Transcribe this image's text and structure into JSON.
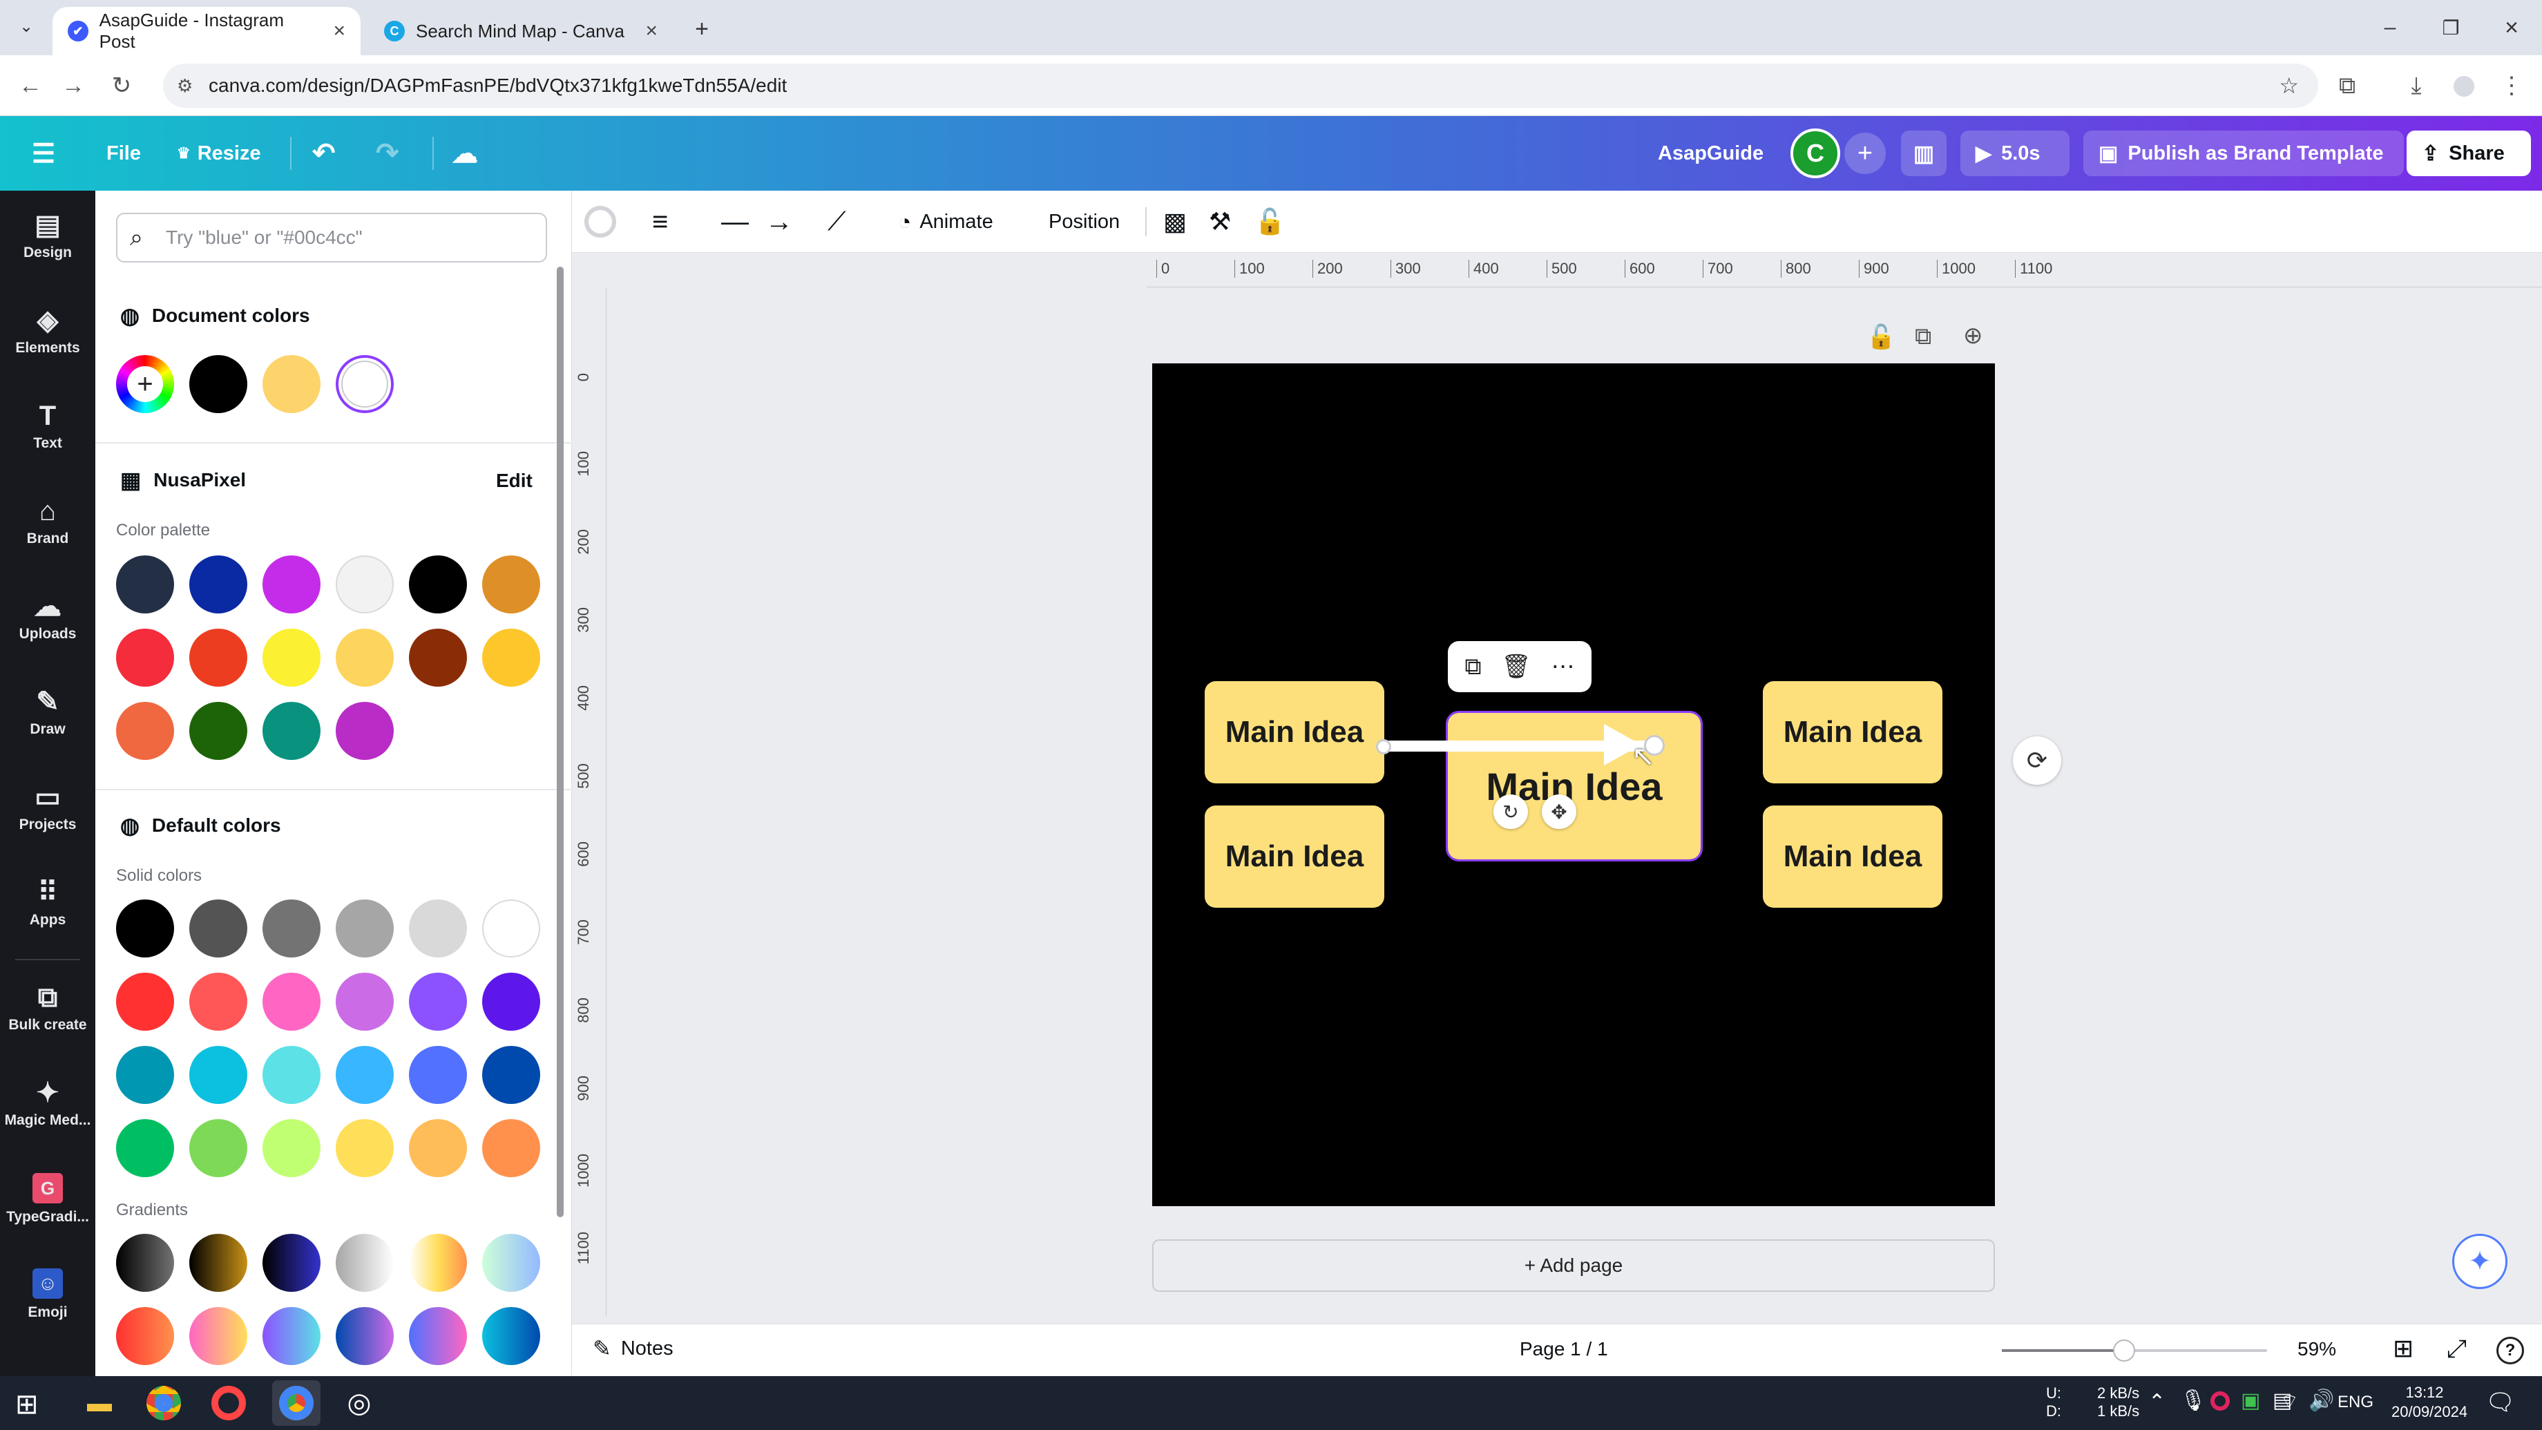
{
  "browser": {
    "tabs": [
      {
        "title": "AsapGuide - Instagram Post",
        "icon": "canva-shield-icon",
        "active": true
      },
      {
        "title": "Search Mind Map - Canva",
        "icon": "canva-icon",
        "active": false
      }
    ],
    "url": "canva.com/design/DAGPmFasnPE/bdVQtx371kfg1kweTdn55A/edit"
  },
  "header": {
    "file_label": "File",
    "resize_label": "Resize",
    "team_name": "AsapGuide",
    "avatar_letter": "C",
    "play_label": "5.0s",
    "publish_label": "Publish as Brand Template",
    "share_label": "Share"
  },
  "rail": [
    {
      "label": "Design",
      "icon": "design-icon"
    },
    {
      "label": "Elements",
      "icon": "elements-icon"
    },
    {
      "label": "Text",
      "icon": "text-icon"
    },
    {
      "label": "Brand",
      "icon": "brand-icon"
    },
    {
      "label": "Uploads",
      "icon": "uploads-icon"
    },
    {
      "label": "Draw",
      "icon": "draw-icon"
    },
    {
      "label": "Projects",
      "icon": "projects-icon"
    },
    {
      "label": "Apps",
      "icon": "apps-icon"
    },
    {
      "label": "Bulk create",
      "icon": "bulk-create-icon"
    },
    {
      "label": "Magic Med...",
      "icon": "magic-media-icon"
    },
    {
      "label": "TypeGradi...",
      "icon": "typegradient-icon"
    },
    {
      "label": "Emoji",
      "icon": "emoji-icon"
    }
  ],
  "panel": {
    "search_placeholder": "Try \"blue\" or \"#00c4cc\"",
    "document_colors_title": "Document colors",
    "document_colors": [
      "#000000",
      "#fdd36b",
      "#ffffff"
    ],
    "brand_title": "NusaPixel",
    "brand_edit": "Edit",
    "palette_label": "Color palette",
    "palette": [
      "#232f45",
      "#0a2aa4",
      "#c52ce9",
      "#f2f2f2",
      "#000000",
      "#de8f27",
      "#f52c3c",
      "#ec3d21",
      "#fbf031",
      "#fdd45d",
      "#8a2d07",
      "#fdc62a",
      "#f06840",
      "#1d6409",
      "#09937f",
      "#b92dc6"
    ],
    "default_title": "Default colors",
    "solid_label": "Solid colors",
    "solid": [
      "#000000",
      "#545454",
      "#737373",
      "#a6a6a6",
      "#d9d9d9",
      "#ffffff",
      "#ff3131",
      "#ff5757",
      "#ff66c4",
      "#cb6ce6",
      "#8c52ff",
      "#5e17eb",
      "#0097b2",
      "#0cc0df",
      "#5ce1e6",
      "#38b6ff",
      "#5271ff",
      "#004aad",
      "#00bf63",
      "#7ed957",
      "#c1ff72",
      "#ffde59",
      "#ffbd59",
      "#ff914d"
    ],
    "gradients_label": "Gradients",
    "gradients": [
      "linear-gradient(90deg,#000000,#737373)",
      "linear-gradient(90deg,#000000,#c89116)",
      "linear-gradient(90deg,#000000,#3533cd)",
      "linear-gradient(90deg,#a6a6a6,#ffffff)",
      "linear-gradient(90deg,#ffffff,#ffde59,#ff914d)",
      "linear-gradient(90deg,#cdffd8,#94b9ff)",
      "linear-gradient(90deg,#ff3131,#ff914d)",
      "linear-gradient(90deg,#ff66c4,#ffde59)",
      "linear-gradient(90deg,#8c52ff,#5ce1e6)",
      "linear-gradient(90deg,#004aad,#cb6ce6)",
      "linear-gradient(90deg,#5170ff,#ff66c4)",
      "linear-gradient(90deg,#0cc0df,#004aad)"
    ]
  },
  "toolbar": {
    "animate_label": "Animate",
    "position_label": "Position"
  },
  "ruler": {
    "h": [
      "0",
      "100",
      "200",
      "300",
      "400",
      "500",
      "600",
      "700",
      "800",
      "900",
      "1000",
      "1100"
    ],
    "v": [
      "0",
      "100",
      "200",
      "300",
      "400",
      "500",
      "600",
      "700",
      "800",
      "900",
      "1000",
      "1100"
    ]
  },
  "canvas": {
    "cards": [
      "Main Idea",
      "Main Idea",
      "Main Idea",
      "Main Idea",
      "Main Idea"
    ],
    "background": "#000000",
    "card_color": "#fde07c"
  },
  "add_page_label": "+ Add page",
  "footer": {
    "notes_label": "Notes",
    "page_label": "Page 1 / 1",
    "zoom_label": "59%",
    "zoom_fraction": 0.46
  },
  "taskbar": {
    "net_up_label": "U:",
    "net_up": "2 kB/s",
    "net_down_label": "D:",
    "net_down": "1 kB/s",
    "lang": "ENG",
    "time": "13:12",
    "date": "20/09/2024"
  }
}
